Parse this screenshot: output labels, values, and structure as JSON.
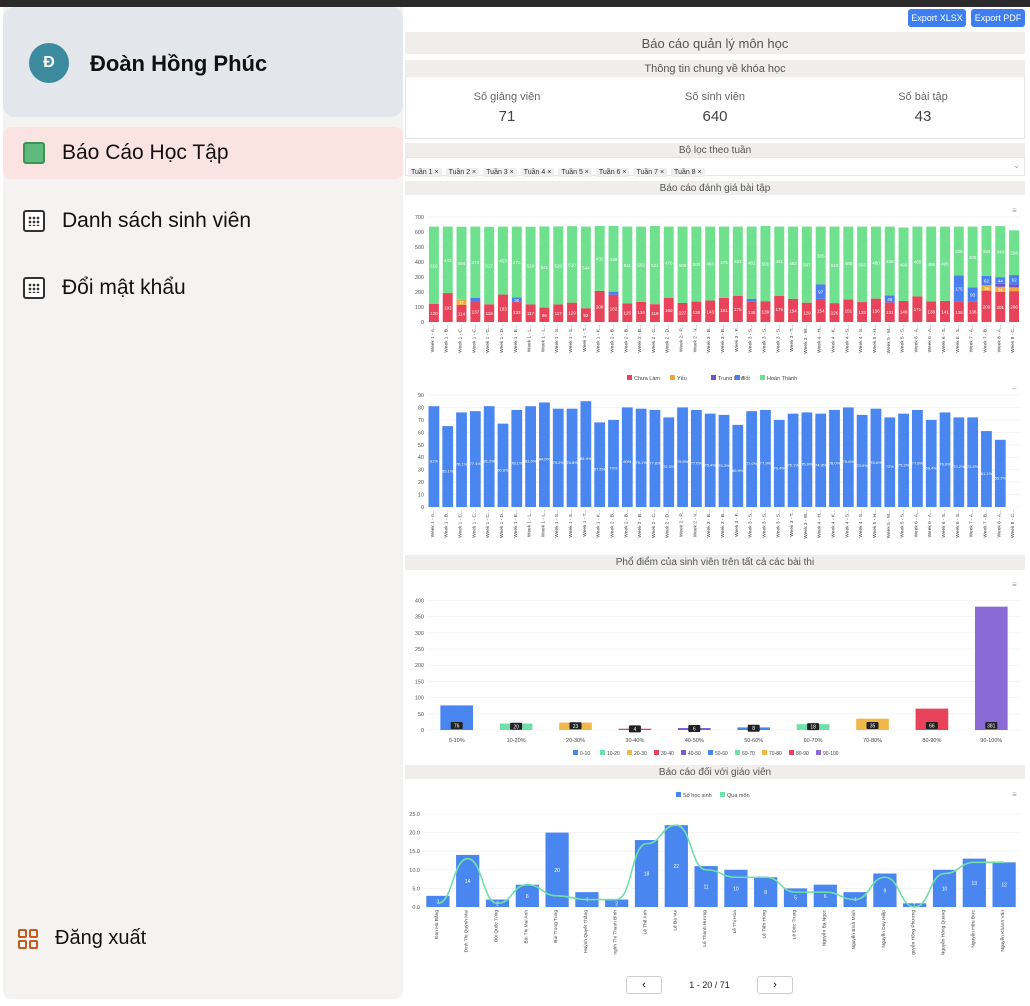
{
  "user": {
    "initial": "Đ",
    "name": "Đoàn Hồng Phúc"
  },
  "nav": [
    {
      "label": "Báo Cáo Học Tập",
      "icon": "report-icon",
      "active": true
    },
    {
      "label": "Danh sách sinh viên",
      "icon": "calendar-grid-icon",
      "active": false
    },
    {
      "label": "Đổi mật khẩu",
      "icon": "calendar-grid-icon",
      "active": false
    }
  ],
  "logout": {
    "label": "Đăng xuất",
    "icon": "grid-icon"
  },
  "toolbar": {
    "export_xlsx": "Export XLSX",
    "export_pdf": "Export PDF"
  },
  "page_title": "Báo cáo quản lý môn học",
  "info": {
    "title": "Thông tin chung về khóa học",
    "stats": [
      {
        "label": "Số giảng viên",
        "value": "71"
      },
      {
        "label": "Số sinh viên",
        "value": "640"
      },
      {
        "label": "Số bài tập",
        "value": "43"
      }
    ]
  },
  "filter": {
    "title": "Bộ lọc theo tuần",
    "chips": [
      "Tuần 1",
      "Tuần 2",
      "Tuần 3",
      "Tuần 4",
      "Tuần 5",
      "Tuần 6",
      "Tuần 7",
      "Tuần 8"
    ]
  },
  "report1_title": "Báo cáo đánh giá bài tập",
  "dist_title": "Phổ điểm của sinh viên trên tất cả các bài thi",
  "teacher_title": "Báo cáo đối với giáo viên",
  "pager": {
    "text": "1 - 20 / 71",
    "prev": "‹",
    "next": "›"
  },
  "colors": {
    "chua_lam": "#e8435a",
    "yeu": "#f0a83c",
    "trung_binh": "#6f55c8",
    "tot": "#4a7ff0",
    "hoan_thanh": "#6ee08e",
    "bar": "#4a86ef",
    "line": "#6ee0a8"
  },
  "chart_data": [
    {
      "type": "bar",
      "stacked": true,
      "categories": [
        "Week 1 - A...",
        "Week 1 - B...",
        "Week 1 - C...",
        "Week 1 - C...",
        "Week 1 - C...",
        "Week 1 - D...",
        "Week 1 - E...",
        "Week 1 - L...",
        "Week 1 - L...",
        "Week 1 - S...",
        "Week 1 - S...",
        "Week 1 - T...",
        "Week 1 - K...",
        "Week 2 - B...",
        "Week 2 - B...",
        "Week 2 - B...",
        "Week 2 - C...",
        "Week 2 - D...",
        "Week 2 - P...",
        "Week 2 - V...",
        "Week 3 - B...",
        "Week 3 - B...",
        "Week 3 - F...",
        "Week 3 - S...",
        "Week 3 - S...",
        "Week 3 - S...",
        "Week 3 - T...",
        "Week 3 - W...",
        "Week 4 - H...",
        "Week 4 - K...",
        "Week 4 - S...",
        "Week 4 - S...",
        "Week 5 - H...",
        "Week 5 - M...",
        "Week 5 - S...",
        "Week 6 - A...",
        "Week 6 - A...",
        "Week 6 - S...",
        "Week 6 - S...",
        "Week 7 - A...",
        "Week 7 - B...",
        "Week 8 - A...",
        "Week 8 - C..."
      ],
      "series": [
        {
          "name": "Chưa Làm",
          "values": [
            120,
            193,
            114,
            137,
            118,
            183,
            133,
            117,
            96,
            117,
            129,
            92,
            208,
            182,
            125,
            134,
            119,
            160,
            127,
            136,
            143,
            161,
            175,
            135,
            139,
            175,
            154,
            129,
            154,
            126,
            151,
            133,
            156,
            131,
            140,
            171,
            138,
            141,
            136,
            138,
            209,
            201,
            206
          ]
        },
        {
          "name": "Yếu",
          "values": [
            0,
            0,
            37,
            0,
            0,
            0,
            0,
            0,
            0,
            0,
            0,
            0,
            0,
            0,
            0,
            0,
            0,
            0,
            0,
            0,
            0,
            0,
            0,
            0,
            0,
            0,
            0,
            0,
            0,
            0,
            0,
            0,
            0,
            0,
            0,
            0,
            0,
            0,
            0,
            0,
            36,
            34,
            25
          ]
        },
        {
          "name": "Trung Bình",
          "values": [
            0,
            0,
            0,
            0,
            0,
            0,
            0,
            0,
            0,
            0,
            0,
            0,
            0,
            0,
            0,
            0,
            0,
            0,
            0,
            0,
            0,
            0,
            0,
            0,
            0,
            0,
            0,
            0,
            0,
            0,
            0,
            0,
            0,
            0,
            0,
            0,
            0,
            0,
            0,
            0,
            0,
            20,
            20
          ]
        },
        {
          "name": "Tốt",
          "values": [
            0,
            0,
            0,
            25,
            0,
            0,
            30,
            0,
            0,
            0,
            0,
            0,
            0,
            20,
            0,
            0,
            0,
            0,
            0,
            0,
            0,
            0,
            0,
            20,
            0,
            0,
            0,
            0,
            97,
            0,
            0,
            0,
            0,
            46,
            0,
            0,
            0,
            0,
            175,
            93,
            62,
            44,
            62
          ]
        },
        {
          "name": "Hoàn Thành",
          "values": [
            516,
            443,
            484,
            474,
            517,
            453,
            473,
            518,
            541,
            520,
            510,
            544,
            432,
            438,
            511,
            502,
            521,
            476,
            509,
            500,
            493,
            475,
            461,
            481,
            501,
            461,
            482,
            507,
            385,
            510,
            485,
            503,
            480,
            459,
            490,
            465,
            498,
            495,
            325,
            405,
            333,
            340,
            298
          ]
        }
      ],
      "ylim": [
        0,
        700
      ],
      "legend": "bottom"
    },
    {
      "type": "bar",
      "categories": [
        "Week 1 - A...",
        "Week 1 - B...",
        "Week 1 - C...",
        "Week 1 - C...",
        "Week 1 - C...",
        "Week 1 - D...",
        "Week 1 - E...",
        "Week 1 - L...",
        "Week 1 - L...",
        "Week 1 - S...",
        "Week 1 - S...",
        "Week 1 - T...",
        "Week 1 - K...",
        "Week 2 - B...",
        "Week 2 - B...",
        "Week 2 - B...",
        "Week 2 - C...",
        "Week 2 - D...",
        "Week 2 - P...",
        "Week 2 - V...",
        "Week 3 - B...",
        "Week 3 - B...",
        "Week 3 - F...",
        "Week 3 - S...",
        "Week 3 - S...",
        "Week 3 - S...",
        "Week 3 - T...",
        "Week 3 - W...",
        "Week 4 - H...",
        "Week 4 - K...",
        "Week 4 - S...",
        "Week 4 - S...",
        "Week 5 - H...",
        "Week 5 - M...",
        "Week 5 - S...",
        "Week 6 - A...",
        "Week 6 - A...",
        "Week 6 - S...",
        "Week 6 - S...",
        "Week 7 - A...",
        "Week 7 - B...",
        "Week 8 - A...",
        "Week 8 - C..."
      ],
      "values": [
        81,
        65,
        76,
        77,
        81,
        67,
        78,
        81,
        84,
        79,
        79,
        85,
        68,
        70,
        80,
        79,
        78,
        72,
        80,
        78,
        75,
        74,
        66,
        77,
        78,
        70,
        75,
        76,
        75,
        78,
        80,
        74,
        79,
        72,
        75,
        78,
        70,
        76,
        72,
        72,
        61,
        54,
        0
      ],
      "labels": [
        "81%",
        "65.1%",
        "76.1%",
        "77.4%",
        "81.2%",
        "66.8%",
        "78.1%",
        "81.6%",
        "84.0%",
        "79.2%",
        "78.8%",
        "84.9%",
        "67.5%",
        "70%",
        "80%",
        "79.1%",
        "77.8%",
        "72.3%",
        "79.5%",
        "77.6%",
        "75.4%",
        "74.3%",
        "65.9%",
        "77.0%",
        "77.9%",
        "70.4%",
        "75.1%",
        "75.9%",
        "74.9%",
        "78.0%",
        "79.6%",
        "73.9%",
        "78.6%",
        "72%",
        "75.2%",
        "77.6%",
        "69.4%",
        "76.0%",
        "72.2%",
        "72.2%",
        "61.1%",
        "53.7%",
        ""
      ],
      "ylim": [
        0,
        90
      ]
    },
    {
      "type": "bar",
      "categories": [
        "0-10%",
        "10-20%",
        "20-30%",
        "30-40%",
        "40-50%",
        "50-60%",
        "60-70%",
        "70-80%",
        "80-90%",
        "90-100%"
      ],
      "values": [
        76,
        20,
        23,
        4,
        6,
        8,
        18,
        35,
        66,
        381
      ],
      "legend": [
        "0-10",
        "10-20",
        "20-30",
        "30-40",
        "40-50",
        "50-60",
        "60-70",
        "70-80",
        "80-90",
        "90-100"
      ],
      "ylim": [
        0,
        420
      ],
      "colors": [
        "#4a86ef",
        "#6ee0a8",
        "#f0b84a",
        "#e8435a",
        "#7c5cd0",
        "#4a86ef",
        "#6ee0a8",
        "#f0b84a",
        "#e8435a",
        "#8a6ad4"
      ]
    },
    {
      "type": "bar+line",
      "categories": [
        "Đan Hà Bằng",
        "Đinh Thị Quỳnh Mai",
        "Bùi Quốc Tùng",
        "Bùi Thị Mai Anh",
        "Bùi Trọng Tùng",
        "Huỳnh Quyết Thắng",
        "nghh Thị Thanh Bình",
        "Lê Thế Anh",
        "Lê Bá Vui",
        "Lê Thanh Hương",
        "Lê Thị Hoa",
        "Lê Tiến Hùng",
        "Lê Đức Trung",
        "Nguyễn Bá Ngọc",
        "Nguyễn Bình Minh",
        "Nguyễn Duy Hiệp",
        "guyễn Hồng Phương",
        "Nguyễn Hồng Quang",
        "Nguyễn Hữu Đức",
        "Nguyễn Khánh Văn"
      ],
      "series": [
        {
          "name": "Số học sinh",
          "values": [
            3,
            14,
            2,
            6,
            20,
            4,
            2,
            18,
            22,
            11,
            10,
            8,
            5,
            6,
            4,
            9,
            1,
            10,
            13,
            12
          ]
        },
        {
          "name": "Qua môn",
          "values": [
            1,
            13,
            1,
            6,
            3,
            2,
            2,
            17,
            22,
            10,
            8,
            8,
            4,
            4,
            2,
            8,
            0,
            9,
            12,
            12
          ]
        }
      ],
      "ylim": [
        0,
        25
      ],
      "legend": "top"
    }
  ]
}
